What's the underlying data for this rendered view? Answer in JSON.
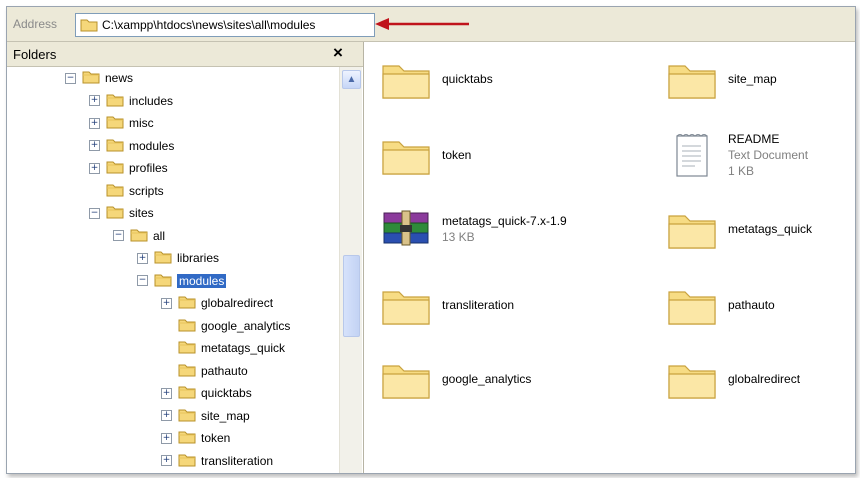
{
  "address": {
    "label": "Address",
    "path": "C:\\xampp\\htdocs\\news\\sites\\all\\modules"
  },
  "folders_pane": {
    "title": "Folders",
    "close_symbol": "×",
    "tree": [
      {
        "label": "news",
        "expander": "−"
      },
      {
        "label": "includes",
        "expander": "+"
      },
      {
        "label": "misc",
        "expander": "+"
      },
      {
        "label": "modules",
        "expander": "+"
      },
      {
        "label": "profiles",
        "expander": "+"
      },
      {
        "label": "scripts",
        "expander": ""
      },
      {
        "label": "sites",
        "expander": "−"
      },
      {
        "label": "all",
        "expander": "−"
      },
      {
        "label": "libraries",
        "expander": "+"
      },
      {
        "label": "modules",
        "expander": "−"
      },
      {
        "label": "globalredirect",
        "expander": "+"
      },
      {
        "label": "google_analytics",
        "expander": ""
      },
      {
        "label": "metatags_quick",
        "expander": ""
      },
      {
        "label": "pathauto",
        "expander": ""
      },
      {
        "label": "quicktabs",
        "expander": "+"
      },
      {
        "label": "site_map",
        "expander": "+"
      },
      {
        "label": "token",
        "expander": "+"
      },
      {
        "label": "transliteration",
        "expander": "+"
      }
    ]
  },
  "content_items": [
    {
      "name": "quicktabs",
      "icon": "folder-icon"
    },
    {
      "name": "site_map",
      "icon": "folder-icon"
    },
    {
      "name": "token",
      "icon": "folder-icon"
    },
    {
      "name": "README",
      "icon": "text-document-icon",
      "type": "Text Document",
      "size": "1 KB"
    },
    {
      "name": "metatags_quick-7.x-1.9",
      "icon": "archive-icon",
      "size": "13 KB"
    },
    {
      "name": "metatags_quick",
      "icon": "folder-icon"
    },
    {
      "name": "transliteration",
      "icon": "folder-icon"
    },
    {
      "name": "pathauto",
      "icon": "folder-icon"
    },
    {
      "name": "google_analytics",
      "icon": "folder-icon"
    },
    {
      "name": "globalredirect",
      "icon": "folder-icon"
    }
  ],
  "colors": {
    "selection": "#316ac5",
    "arrow": "#c0141c",
    "folder": "#f5d77a"
  }
}
